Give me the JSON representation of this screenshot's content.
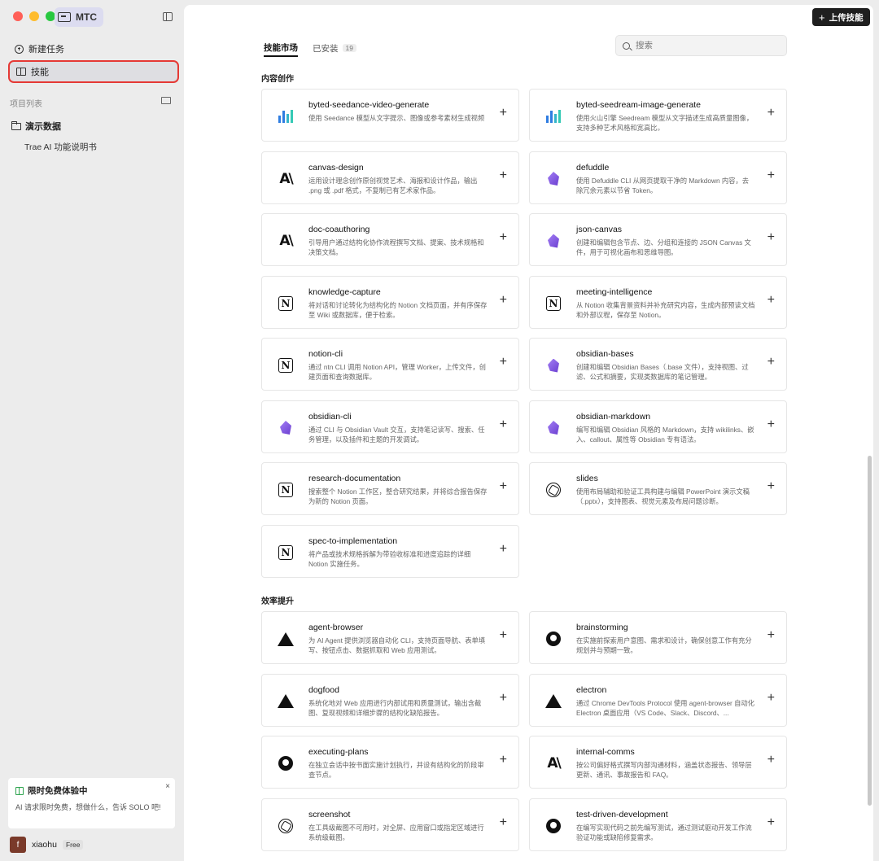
{
  "app": {
    "name": "MTC"
  },
  "sidebar": {
    "new_task": "新建任务",
    "skills": "技能",
    "projects_label": "项目列表",
    "project_name": "演示数据",
    "project_child": "Trae AI 功能说明书",
    "promo": {
      "title": "限时免费体验中",
      "text": "AI 请求限时免费，想做什么，告诉 SOLO 吧!",
      "close": "×"
    },
    "user": {
      "avatar_letter": "f",
      "name": "xiaohu",
      "plan": "Free"
    }
  },
  "header": {
    "upload_label": "上传技能",
    "tabs": [
      {
        "label": "技能市场",
        "active": true
      },
      {
        "label": "已安装",
        "count": "19"
      }
    ],
    "search_placeholder": "搜索"
  },
  "categories": [
    {
      "title": "内容创作",
      "skills": [
        {
          "name": "byted-seedance-video-generate",
          "desc": "使用 Seedance 模型从文字提示、图像或参考素材生成视频",
          "icon": "bars-icon"
        },
        {
          "name": "byted-seedream-image-generate",
          "desc": "使用火山引擎 Seedream 模型从文字描述生成高质量图像，支持多种艺术风格和宽高比。",
          "icon": "bars-icon"
        },
        {
          "name": "canvas-design",
          "desc": "运用设计理念创作原创视觉艺术、海报和设计作品，输出 .png 或 .pdf 格式，不复制已有艺术家作品。",
          "icon": "anthropic-icon"
        },
        {
          "name": "defuddle",
          "desc": "使用 Defuddle CLI 从网页提取干净的 Markdown 内容，去除冗余元素以节省 Token。",
          "icon": "obsidian-icon"
        },
        {
          "name": "doc-coauthoring",
          "desc": "引导用户通过结构化协作流程撰写文档、提案、技术规格和决策文档。",
          "icon": "anthropic-icon"
        },
        {
          "name": "json-canvas",
          "desc": "创建和编辑包含节点、边、分组和连接的 JSON Canvas 文件，用于可视化画布和思维导图。",
          "icon": "obsidian-icon"
        },
        {
          "name": "knowledge-capture",
          "desc": "将对话和讨论转化为结构化的 Notion 文档页面，并有序保存至 Wiki 或数据库，便于检索。",
          "icon": "notion-icon"
        },
        {
          "name": "meeting-intelligence",
          "desc": "从 Notion 收集背景资料并补充研究内容，生成内部预读文档和外部议程，保存至 Notion。",
          "icon": "notion-icon"
        },
        {
          "name": "notion-cli",
          "desc": "通过 ntn CLI 调用 Notion API，管理 Worker，上传文件，创建页面和查询数据库。",
          "icon": "notion-icon"
        },
        {
          "name": "obsidian-bases",
          "desc": "创建和编辑 Obsidian Bases（.base 文件），支持视图、过滤、公式和摘要，实现类数据库的笔记管理。",
          "icon": "obsidian-icon"
        },
        {
          "name": "obsidian-cli",
          "desc": "通过 CLI 与 Obsidian Vault 交互，支持笔记读写、搜索、任务管理，以及插件和主题的开发调试。",
          "icon": "obsidian-icon"
        },
        {
          "name": "obsidian-markdown",
          "desc": "编写和编辑 Obsidian 风格的 Markdown，支持 wikilinks、嵌入、callout、属性等 Obsidian 专有语法。",
          "icon": "obsidian-icon"
        },
        {
          "name": "research-documentation",
          "desc": "搜索整个 Notion 工作区，整合研究结果，并将综合报告保存为新的 Notion 页面。",
          "icon": "notion-icon"
        },
        {
          "name": "slides",
          "desc": "使用布局辅助和验证工具构建与编辑 PowerPoint 演示文稿（.pptx），支持图表、视觉元素及布局问题诊断。",
          "icon": "openai-icon"
        },
        {
          "name": "spec-to-implementation",
          "desc": "将产品或技术规格拆解为带验收标准和进度追踪的详细 Notion 实施任务。",
          "icon": "notion-icon"
        }
      ]
    },
    {
      "title": "效率提升",
      "skills": [
        {
          "name": "agent-browser",
          "desc": "为 AI Agent 提供浏览器自动化 CLI，支持页面导航、表单填写、按钮点击、数据抓取和 Web 应用测试。",
          "icon": "vercel-icon"
        },
        {
          "name": "brainstorming",
          "desc": "在实施前探索用户意图、需求和设计，确保创意工作有充分规划并与预期一致。",
          "icon": "github-icon"
        },
        {
          "name": "dogfood",
          "desc": "系统化地对 Web 应用进行内部试用和质量测试，输出含截图、复现视频和详细步骤的结构化缺陷报告。",
          "icon": "vercel-icon"
        },
        {
          "name": "electron",
          "desc": "通过 Chrome DevTools Protocol 使用 agent-browser 自动化 Electron 桌面应用（VS Code、Slack、Discord、...",
          "icon": "vercel-icon"
        },
        {
          "name": "executing-plans",
          "desc": "在独立会话中按书面实施计划执行，并设有结构化的阶段审查节点。",
          "icon": "github-icon"
        },
        {
          "name": "internal-comms",
          "desc": "按公司偏好格式撰写内部沟通材料，涵盖状态报告、领导层更新、通讯、事故报告和 FAQ。",
          "icon": "anthropic-icon"
        },
        {
          "name": "screenshot",
          "desc": "在工具级截图不可用时，对全屏、应用窗口或指定区域进行系统级截图。",
          "icon": "openai-icon"
        },
        {
          "name": "test-driven-development",
          "desc": "在编写实现代码之前先编写测试，通过测试驱动开发工作流验证功能或缺陷修复需求。",
          "icon": "github-icon"
        }
      ]
    }
  ],
  "card_add_label": "+"
}
